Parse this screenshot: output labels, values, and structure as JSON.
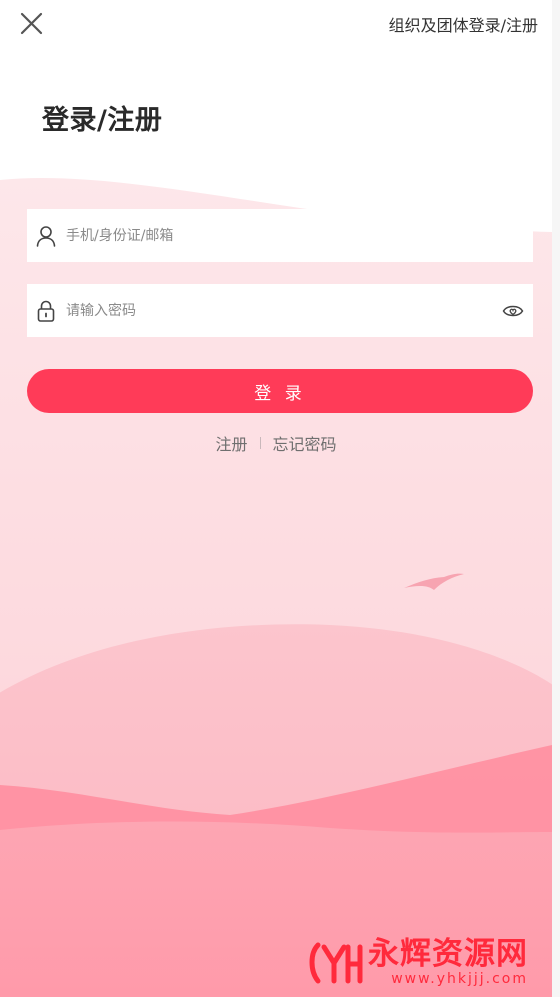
{
  "header": {
    "close_icon": "close-icon",
    "org_link": "组织及团体登录/注册"
  },
  "title": "登录/注册",
  "form": {
    "account": {
      "icon": "user-icon",
      "placeholder": "手机/身份证/邮箱",
      "value": ""
    },
    "password": {
      "icon": "lock-icon",
      "placeholder": "请输入密码",
      "value": "",
      "toggle_icon": "eye-icon"
    },
    "login_button": "登 录"
  },
  "links": {
    "register": "注册",
    "forgot_password": "忘记密码"
  },
  "watermark": {
    "title": "永辉资源网",
    "url": "www.yhkjjj.com"
  },
  "colors": {
    "accent": "#ff3b58",
    "background_top": "#fde3e6",
    "background_bottom": "#ff8d9c"
  }
}
